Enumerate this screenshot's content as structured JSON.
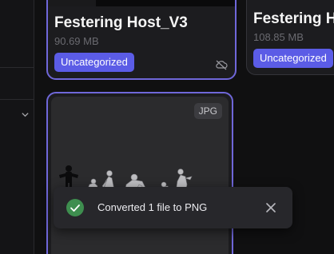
{
  "cards": [
    {
      "title": "Festering Host_V3",
      "size": "90.69 MB",
      "tag": "Uncategorized",
      "sync_icon": "cloud-off-icon"
    },
    {
      "title": "Festering Ho",
      "size": "108.85 MB",
      "tag": "Uncategorized"
    }
  ],
  "preview": {
    "format": "JPG"
  },
  "toast": {
    "message": "Converted 1 file to PNG",
    "status_icon": "check-circle-icon",
    "close_icon": "close-icon"
  },
  "sidebar": {
    "chevron_icon": "chevron-down-icon"
  },
  "colors": {
    "accent": "#5b5ce6",
    "selected_border": "#6f67d9",
    "success": "#3e8e4f"
  }
}
